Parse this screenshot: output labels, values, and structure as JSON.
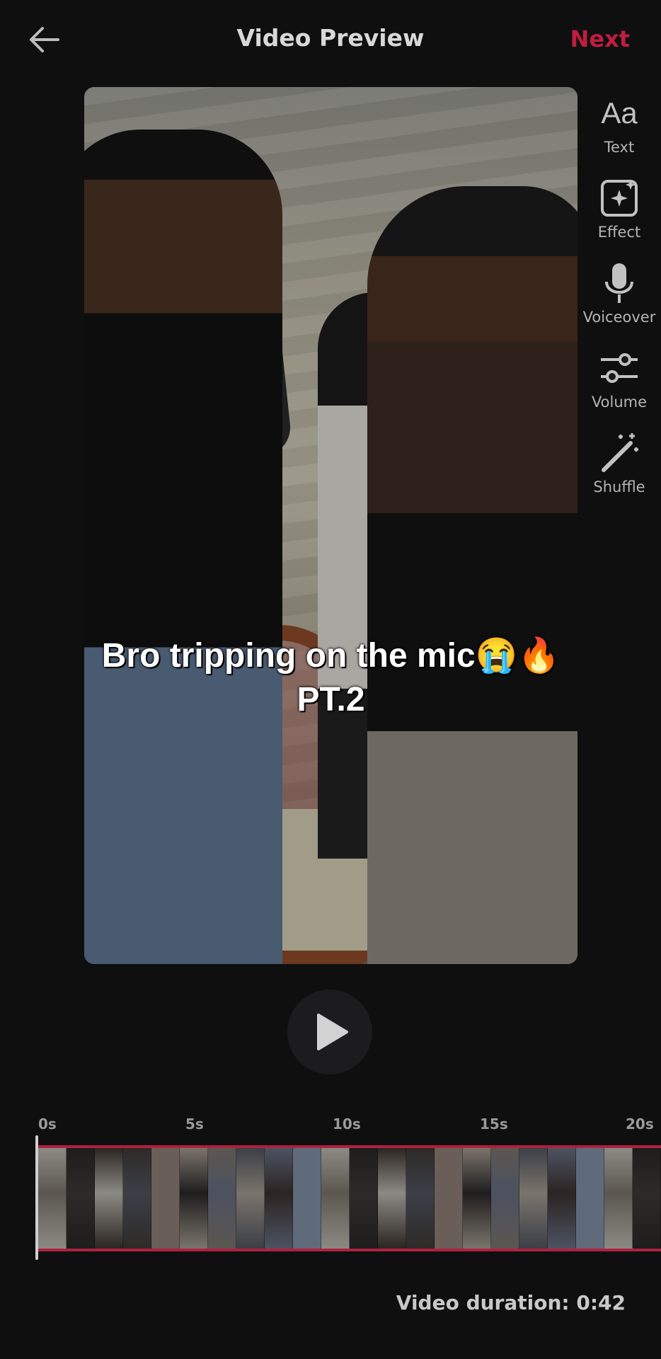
{
  "header": {
    "back_icon": "arrow-left-icon",
    "title": "Video Preview",
    "next_label": "Next",
    "accent_color": "#e0204a"
  },
  "video": {
    "caption_line1": "Bro tripping on the mic😭🔥",
    "caption_line2": "PT.2"
  },
  "tools": [
    {
      "label": "Text",
      "icon": "text-aa-icon",
      "glyph": "Aa"
    },
    {
      "label": "Effect",
      "icon": "sparkle-effect-icon"
    },
    {
      "label": "Voiceover",
      "icon": "microphone-icon"
    },
    {
      "label": "Volume",
      "icon": "sliders-icon"
    },
    {
      "label": "Shuffle",
      "icon": "magic-wand-icon"
    }
  ],
  "playback": {
    "play_icon": "play-icon"
  },
  "timeline": {
    "ticks": [
      "0s",
      "5s",
      "10s",
      "15s",
      "20s"
    ],
    "border_color": "#b0213f"
  },
  "footer": {
    "duration_text": "Video duration: 0:42"
  }
}
